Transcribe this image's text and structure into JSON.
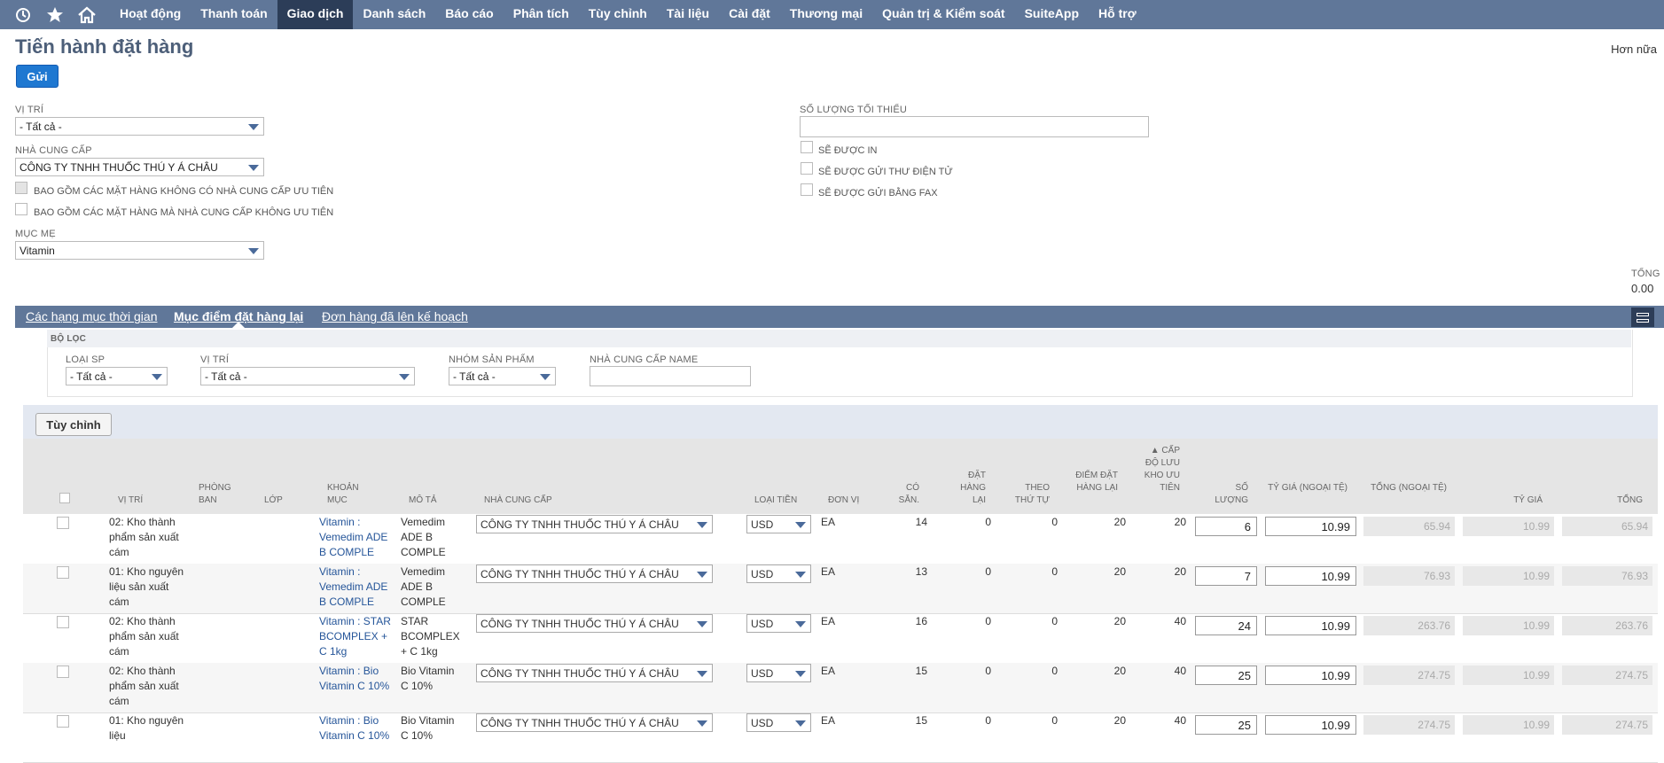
{
  "nav": {
    "icons": [
      "recent-icon",
      "star-icon",
      "home-icon"
    ],
    "items": [
      "Hoạt động",
      "Thanh toán",
      "Giao dịch",
      "Danh sách",
      "Báo cáo",
      "Phân tích",
      "Tùy chỉnh",
      "Tài liệu",
      "Cài đặt",
      "Thương mại",
      "Quản trị & Kiểm soát",
      "SuiteApp",
      "Hỗ trợ"
    ],
    "active": "Giao dịch"
  },
  "page": {
    "title": "Tiến hành đặt hàng",
    "more": "Hơn nữa",
    "submit": "Gửi"
  },
  "form": {
    "location_label": "VỊ TRÍ",
    "location_value": "- Tất cả -",
    "vendor_label": "NHÀ CUNG CẤP",
    "vendor_value": "CÔNG TY TNHH THUỐC THÚ Y Á CHÂU",
    "cb_no_pref_vendor": "BAO GỒM CÁC MẶT HÀNG KHÔNG CÓ NHÀ CUNG CẤP ƯU TIÊN",
    "cb_not_pref_vendor": "BAO GỒM CÁC MẶT HÀNG MÀ NHÀ CUNG CẤP KHÔNG ƯU TIÊN",
    "parent_label": "MỤC MẸ",
    "parent_value": "Vitamin",
    "min_qty_label": "SỐ LƯỢNG TỐI THIỂU",
    "cb_print": "SẼ ĐƯỢC IN",
    "cb_email": "SẼ ĐƯỢC GỬI THƯ ĐIỆN TỬ",
    "cb_fax": "SẼ ĐƯỢC GỬI BẰNG FAX",
    "total_label": "TỔNG",
    "total_value": "0.00"
  },
  "tabs": [
    "Các hạng mục thời gian",
    "Mục điểm đặt hàng lại",
    "Đơn hàng đã lên kế hoạch"
  ],
  "filter": {
    "title": "BỘ LỌC",
    "type_label": "LOẠI SP",
    "type_value": "- Tất cả -",
    "loc_label": "VỊ TRÍ",
    "loc_value": "- Tất cả -",
    "group_label": "NHÓM SẢN PHẨM",
    "group_value": "- Tất cả -",
    "vendor_name_label": "NHÀ CUNG CẤP NAME"
  },
  "customize": "Tùy chỉnh",
  "columns": {
    "location": "VỊ TRÍ",
    "department": "PHÒNG BAN",
    "class": "LỚP",
    "item": "KHOẢN MỤC",
    "description": "MÔ TẢ",
    "vendor": "NHÀ CUNG CẤP",
    "currency": "LOẠI TIỀN",
    "unit": "ĐƠN VỊ",
    "available": "CÓ SẴN.",
    "reorder": "ĐẶT HÀNG LẠI",
    "on_order": "THEO THỨ TỰ",
    "reorder_point": "ĐIỂM ĐẶT HÀNG LẠI",
    "pref_stock": "▲ CẤP ĐỘ LƯU KHO ƯU TIÊN",
    "qty": "SỐ LƯỢNG",
    "rate_fx": "TỶ GIÁ (NGOẠI TỆ)",
    "total_fx": "TỔNG (NGOẠI TỆ)",
    "rate": "TỶ GIÁ",
    "total": "TỔNG"
  },
  "rows": [
    {
      "location": "02: Kho thành phẩm sản xuất cám",
      "item": "Vitamin : Vemedim ADE B COMPLE",
      "description": "Vemedim ADE B COMPLE",
      "vendor": "CÔNG TY TNHH THUỐC THÚ Y Á CHÂU",
      "currency": "USD",
      "unit": "EA",
      "available": "14",
      "reorder": "0",
      "on_order": "0",
      "reorder_point": "20",
      "pref_stock": "20",
      "qty": "6",
      "rate_fx": "10.99",
      "total_fx": "65.94",
      "rate": "10.99",
      "total": "65.94"
    },
    {
      "location": "01: Kho nguyên liệu sản xuất cám",
      "item": "Vitamin : Vemedim ADE B COMPLE",
      "description": "Vemedim ADE B COMPLE",
      "vendor": "CÔNG TY TNHH THUỐC THÚ Y Á CHÂU",
      "currency": "USD",
      "unit": "EA",
      "available": "13",
      "reorder": "0",
      "on_order": "0",
      "reorder_point": "20",
      "pref_stock": "20",
      "qty": "7",
      "rate_fx": "10.99",
      "total_fx": "76.93",
      "rate": "10.99",
      "total": "76.93"
    },
    {
      "location": "02: Kho thành phẩm sản xuất cám",
      "item": "Vitamin : STAR BCOMPLEX + C 1kg",
      "description": "STAR BCOMPLEX + C 1kg",
      "vendor": "CÔNG TY TNHH THUỐC THÚ Y Á CHÂU",
      "currency": "USD",
      "unit": "EA",
      "available": "16",
      "reorder": "0",
      "on_order": "0",
      "reorder_point": "20",
      "pref_stock": "40",
      "qty": "24",
      "rate_fx": "10.99",
      "total_fx": "263.76",
      "rate": "10.99",
      "total": "263.76"
    },
    {
      "location": "02: Kho thành phẩm sản xuất cám",
      "item": "Vitamin : Bio Vitamin C 10%",
      "description": "Bio Vitamin C 10%",
      "vendor": "CÔNG TY TNHH THUỐC THÚ Y Á CHÂU",
      "currency": "USD",
      "unit": "EA",
      "available": "15",
      "reorder": "0",
      "on_order": "0",
      "reorder_point": "20",
      "pref_stock": "40",
      "qty": "25",
      "rate_fx": "10.99",
      "total_fx": "274.75",
      "rate": "10.99",
      "total": "274.75"
    },
    {
      "location": "01: Kho nguyên liệu",
      "item": "Vitamin : Bio Vitamin C 10%",
      "description": "Bio Vitamin C 10%",
      "vendor": "CÔNG TY TNHH THUỐC THÚ Y Á CHÂU",
      "currency": "USD",
      "unit": "EA",
      "available": "15",
      "reorder": "0",
      "on_order": "0",
      "reorder_point": "20",
      "pref_stock": "40",
      "qty": "25",
      "rate_fx": "10.99",
      "total_fx": "274.75",
      "rate": "10.99",
      "total": "274.75"
    }
  ]
}
